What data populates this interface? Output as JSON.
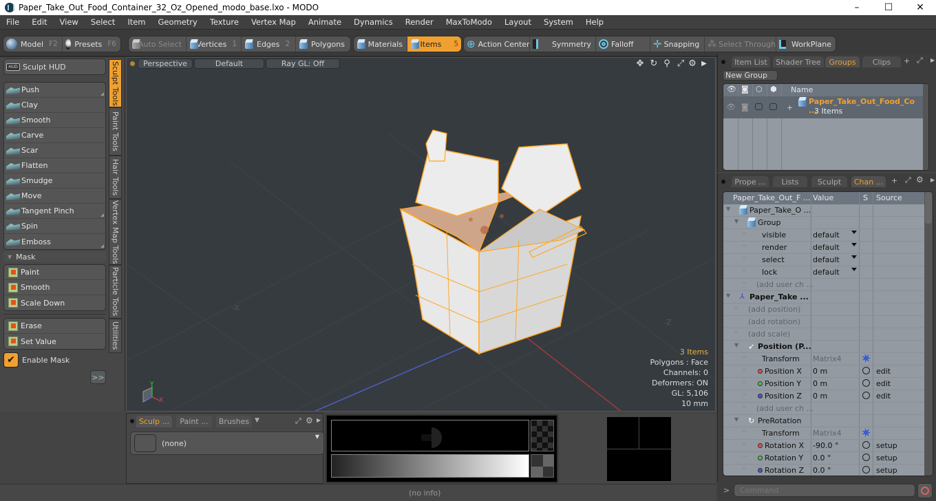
{
  "window": {
    "title": "Paper_Take_Out_Food_Container_32_Oz_Opened_modo_base.lxo - MODO",
    "minimize": "–",
    "maximize": "☐",
    "close": "✕"
  },
  "menu": [
    "File",
    "Edit",
    "View",
    "Select",
    "Item",
    "Geometry",
    "Texture",
    "Vertex Map",
    "Animate",
    "Dynamics",
    "Render",
    "MaxToModo",
    "Layout",
    "System",
    "Help"
  ],
  "toolbar": {
    "model": {
      "label": "Model",
      "key": "F2"
    },
    "presets": {
      "label": "Presets",
      "key": "F6"
    },
    "auto_select": "Auto Select",
    "vertices": {
      "label": "Vertices",
      "key": "1"
    },
    "edges": {
      "label": "Edges",
      "key": "2"
    },
    "polygons": "Polygons",
    "materials": "Materials",
    "items": {
      "label": "Items",
      "key": "5"
    },
    "action_center": "Action Center",
    "symmetry": "Symmetry",
    "falloff": "Falloff",
    "snapping": "Snapping",
    "select_through": "Select Through",
    "workplane": "WorkPlane"
  },
  "left_panel": {
    "sculpt_hud": "Sculpt HUD",
    "sculpt_tools": [
      "Push",
      "Clay",
      "Smooth",
      "Carve",
      "Scar",
      "Flatten",
      "Smudge",
      "Move",
      "Tangent Pinch",
      "Spin",
      "Emboss"
    ],
    "mask_header": "Mask",
    "mask_tools": [
      "Paint",
      "Smooth",
      "Scale Down"
    ],
    "mask_tools2": [
      "Erase",
      "Set Value"
    ],
    "enable_mask": {
      "label": "Enable Mask",
      "checked": true
    },
    "more_button": ">>",
    "vertical_tabs": [
      "Sculpt Tools",
      "Paint Tools",
      "Hair Tools",
      "Vertex Map Tools",
      "Particle Tools",
      "Utilities"
    ],
    "active_vertical_tab": "Sculpt Tools"
  },
  "viewport": {
    "view_mode": "Perspective",
    "shading": "Default",
    "raygl": "Ray GL: Off",
    "axis_label_neg_x": "-X",
    "axis_label_neg_z": "-Z",
    "info": {
      "items": "3 Items",
      "polygons": "Polygons : Face",
      "channels": "Channels: 0",
      "deformers": "Deformers: ON",
      "gl": "GL: 5,106",
      "scale": "10 mm"
    },
    "gizmo": {
      "y": "Y",
      "x": "X",
      "z": "Z"
    }
  },
  "bottom_left": {
    "tabs": [
      "Sculp ...",
      "Paint ...",
      "Brushes"
    ],
    "active_tab": "Sculp ...",
    "brush_value": "(none)"
  },
  "status": {
    "info": "(no info)"
  },
  "groups_panel": {
    "tabs": [
      "Item List",
      "Shader Tree",
      "Groups",
      "Clips"
    ],
    "active_tab": "Groups",
    "new_group": "New Group",
    "column_name": "Name",
    "group": {
      "name": "Paper_Take_Out_Food_Co ...",
      "count": "3 Items"
    }
  },
  "channels_panel": {
    "tabs": [
      "Prope ...",
      "Lists",
      "Sculpt",
      "Chan ..."
    ],
    "active_tab": "Chan ...",
    "columns": [
      "Paper_Take_Out_F ...",
      "Value",
      "S",
      "Source"
    ],
    "rows": [
      {
        "indent": 1,
        "label": "Paper_Take_O ...",
        "type": "item",
        "value": "",
        "source": ""
      },
      {
        "indent": 2,
        "label": "Group",
        "type": "item",
        "value": "",
        "source": ""
      },
      {
        "indent": 3,
        "label": "visible",
        "type": "channel",
        "value": "default",
        "dropdown": true,
        "source": ""
      },
      {
        "indent": 3,
        "label": "render",
        "type": "channel",
        "value": "default",
        "dropdown": true,
        "source": ""
      },
      {
        "indent": 3,
        "label": "select",
        "type": "channel",
        "value": "default",
        "dropdown": true,
        "source": ""
      },
      {
        "indent": 3,
        "label": "lock",
        "type": "channel",
        "value": "default",
        "dropdown": true,
        "source": ""
      },
      {
        "indent": 3,
        "label": "(add user ch ...",
        "type": "add",
        "value": "",
        "source": ""
      },
      {
        "indent": 1,
        "label": "Paper_Take ...",
        "type": "locator",
        "value": "",
        "source": ""
      },
      {
        "indent": 2,
        "label": "(add position)",
        "type": "add",
        "value": "",
        "source": ""
      },
      {
        "indent": 2,
        "label": "(add rotation)",
        "type": "add",
        "value": "",
        "source": ""
      },
      {
        "indent": 2,
        "label": "(add scale)",
        "type": "add",
        "value": "",
        "source": ""
      },
      {
        "indent": 2,
        "label": "Position (P...",
        "type": "xform",
        "value": "",
        "source": ""
      },
      {
        "indent": 3,
        "label": "Transform",
        "type": "matrix",
        "value": "Matrix4",
        "source": ""
      },
      {
        "indent": 3,
        "label": "Position X",
        "type": "axis",
        "color": "#e05050",
        "value": "0 m",
        "source": "edit"
      },
      {
        "indent": 3,
        "label": "Position Y",
        "type": "axis",
        "color": "#50c050",
        "value": "0 m",
        "source": "edit"
      },
      {
        "indent": 3,
        "label": "Position Z",
        "type": "axis",
        "color": "#5050e0",
        "value": "0 m",
        "source": "edit"
      },
      {
        "indent": 3,
        "label": "(add user ch ...",
        "type": "add",
        "value": "",
        "source": ""
      },
      {
        "indent": 2,
        "label": "PreRotation",
        "type": "rot",
        "value": "",
        "source": ""
      },
      {
        "indent": 3,
        "label": "Transform",
        "type": "matrix",
        "value": "Matrix4",
        "source": ""
      },
      {
        "indent": 3,
        "label": "Rotation X",
        "type": "axis",
        "color": "#e05050",
        "value": "-90.0 °",
        "source": "setup"
      },
      {
        "indent": 3,
        "label": "Rotation Y",
        "type": "axis",
        "color": "#50c050",
        "value": "0.0 °",
        "source": "setup"
      },
      {
        "indent": 3,
        "label": "Rotation Z",
        "type": "axis",
        "color": "#5050e0",
        "value": "0.0 °",
        "source": "setup"
      }
    ]
  },
  "command": {
    "placeholder": "Command",
    "prompt": ">"
  },
  "colors": {
    "accent": "#f0a030",
    "selection": "#ffa726"
  }
}
